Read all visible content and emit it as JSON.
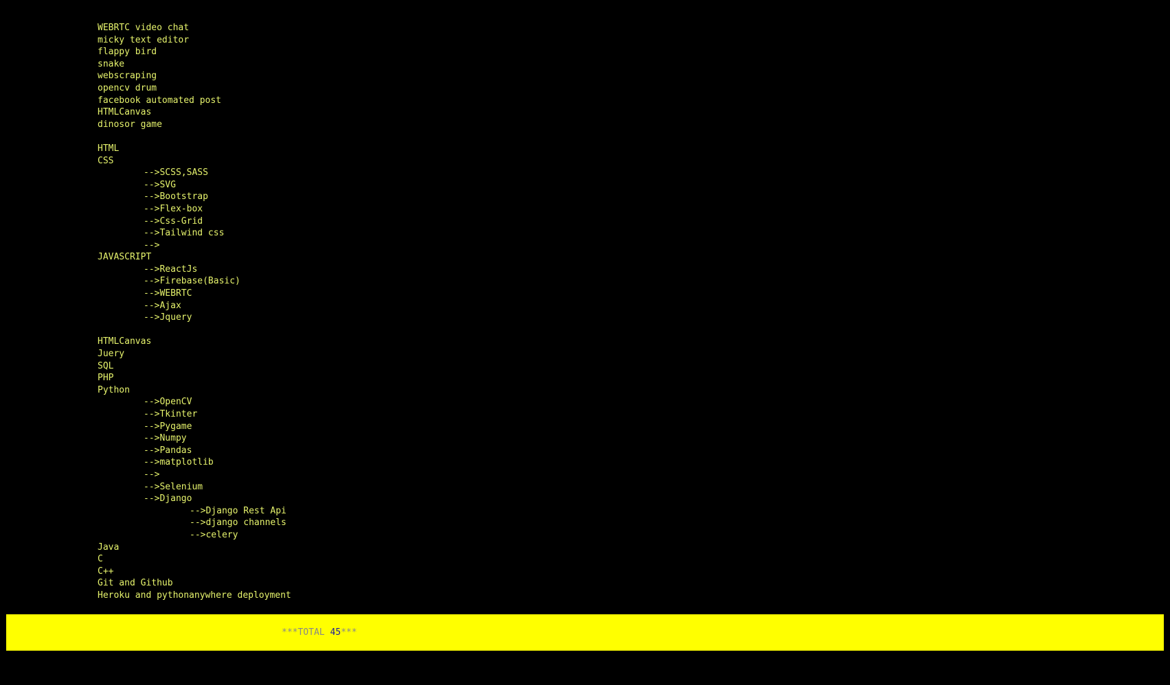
{
  "colors": {
    "background": "#000000",
    "text": "#e6f36c",
    "bar": "#ffff00",
    "total_label": "#888888",
    "total_count": "#1a1aa0"
  },
  "projects": [
    "WEBRTC video chat",
    "micky text editor",
    "flappy bird",
    "snake",
    "webscraping",
    "opencv drum",
    "facebook automated post",
    "HTMLCanvas",
    "dinosor game"
  ],
  "skills": {
    "html": "HTML",
    "css": "CSS",
    "css_children": [
      "-->SCSS,SASS",
      "-->SVG",
      "-->Bootstrap",
      "-->Flex-box",
      "-->Css-Grid",
      "-->Tailwind css",
      "-->"
    ],
    "javascript": "JAVASCRIPT",
    "javascript_children": [
      "-->ReactJs",
      "-->Firebase(Basic)",
      "-->WEBRTC",
      "-->Ajax",
      "-->Jquery"
    ],
    "htmlcanvas": "HTMLCanvas",
    "juery": "Juery",
    "sql": "SQL",
    "php": "PHP",
    "python": "Python",
    "python_children": [
      "-->OpenCV",
      "-->Tkinter",
      "-->Pygame",
      "-->Numpy",
      "-->Pandas",
      "-->matplotlib",
      "-->",
      "-->Selenium",
      "-->Django"
    ],
    "django_children": [
      "-->Django Rest Api",
      "-->django channels",
      "-->celery"
    ],
    "java": "Java",
    "c": "C",
    "cpp": "C++",
    "git": "Git and Github",
    "deployment": "Heroku and pythonanywhere deployment"
  },
  "total": {
    "prefix": "***TOTAL ",
    "count": "45",
    "suffix": "***"
  }
}
